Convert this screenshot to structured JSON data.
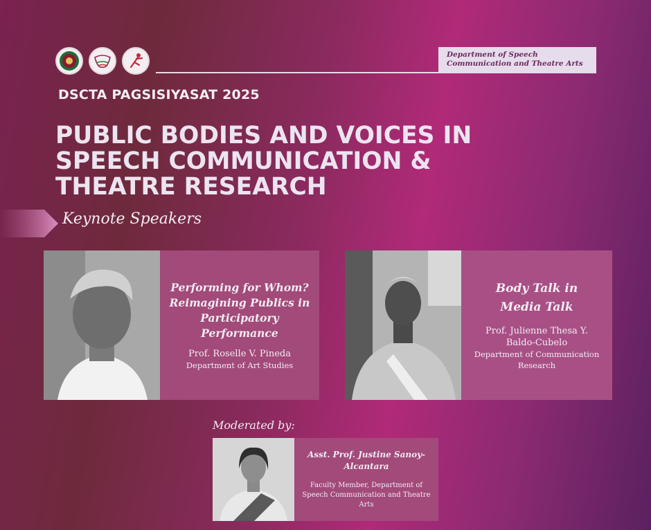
{
  "logos": [
    {
      "icon": "university-seal-icon"
    },
    {
      "icon": "masks-logo-icon"
    },
    {
      "icon": "dancer-logo-icon"
    }
  ],
  "header": {
    "department": "Department of Speech Communication and Theatre Arts",
    "event_name": "DSCTA PAGSISIYASAT 2025",
    "title": "PUBLIC BODIES AND VOICES IN SPEECH COMMUNICATION & THEATRE RESEARCH"
  },
  "keynote_label": "Keynote Speakers",
  "speakers": [
    {
      "talk_title": "Performing for Whom? Reimagining Publics in Participatory Performance",
      "name": "Prof. Roselle V. Pineda",
      "affiliation": "Department of Art Studies"
    },
    {
      "talk_title": "Body Talk in Media Talk",
      "name": "Prof. Julienne Thesa Y. Baldo-Cubelo",
      "affiliation": "Department of Communication Research"
    }
  ],
  "moderator": {
    "label": "Moderated by:",
    "name": "Asst. Prof. Justine Sanoy-Alcantara",
    "affiliation": "Faculty Member, Department of Speech Communication and Theatre Arts"
  },
  "colors": {
    "card_text_panel": "#a24a7a",
    "dept_box": "#e6dcec",
    "title_text": "#ece4f0"
  }
}
